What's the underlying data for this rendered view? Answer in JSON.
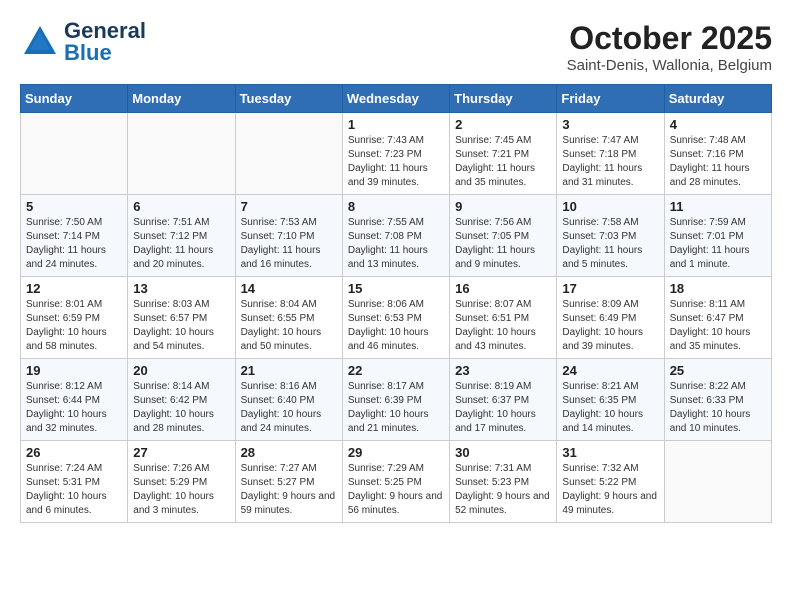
{
  "header": {
    "logo_general": "General",
    "logo_blue": "Blue",
    "month": "October 2025",
    "location": "Saint-Denis, Wallonia, Belgium"
  },
  "days_of_week": [
    "Sunday",
    "Monday",
    "Tuesday",
    "Wednesday",
    "Thursday",
    "Friday",
    "Saturday"
  ],
  "weeks": [
    [
      {
        "num": "",
        "info": ""
      },
      {
        "num": "",
        "info": ""
      },
      {
        "num": "",
        "info": ""
      },
      {
        "num": "1",
        "info": "Sunrise: 7:43 AM\nSunset: 7:23 PM\nDaylight: 11 hours\nand 39 minutes."
      },
      {
        "num": "2",
        "info": "Sunrise: 7:45 AM\nSunset: 7:21 PM\nDaylight: 11 hours\nand 35 minutes."
      },
      {
        "num": "3",
        "info": "Sunrise: 7:47 AM\nSunset: 7:18 PM\nDaylight: 11 hours\nand 31 minutes."
      },
      {
        "num": "4",
        "info": "Sunrise: 7:48 AM\nSunset: 7:16 PM\nDaylight: 11 hours\nand 28 minutes."
      }
    ],
    [
      {
        "num": "5",
        "info": "Sunrise: 7:50 AM\nSunset: 7:14 PM\nDaylight: 11 hours\nand 24 minutes."
      },
      {
        "num": "6",
        "info": "Sunrise: 7:51 AM\nSunset: 7:12 PM\nDaylight: 11 hours\nand 20 minutes."
      },
      {
        "num": "7",
        "info": "Sunrise: 7:53 AM\nSunset: 7:10 PM\nDaylight: 11 hours\nand 16 minutes."
      },
      {
        "num": "8",
        "info": "Sunrise: 7:55 AM\nSunset: 7:08 PM\nDaylight: 11 hours\nand 13 minutes."
      },
      {
        "num": "9",
        "info": "Sunrise: 7:56 AM\nSunset: 7:05 PM\nDaylight: 11 hours\nand 9 minutes."
      },
      {
        "num": "10",
        "info": "Sunrise: 7:58 AM\nSunset: 7:03 PM\nDaylight: 11 hours\nand 5 minutes."
      },
      {
        "num": "11",
        "info": "Sunrise: 7:59 AM\nSunset: 7:01 PM\nDaylight: 11 hours\nand 1 minute."
      }
    ],
    [
      {
        "num": "12",
        "info": "Sunrise: 8:01 AM\nSunset: 6:59 PM\nDaylight: 10 hours\nand 58 minutes."
      },
      {
        "num": "13",
        "info": "Sunrise: 8:03 AM\nSunset: 6:57 PM\nDaylight: 10 hours\nand 54 minutes."
      },
      {
        "num": "14",
        "info": "Sunrise: 8:04 AM\nSunset: 6:55 PM\nDaylight: 10 hours\nand 50 minutes."
      },
      {
        "num": "15",
        "info": "Sunrise: 8:06 AM\nSunset: 6:53 PM\nDaylight: 10 hours\nand 46 minutes."
      },
      {
        "num": "16",
        "info": "Sunrise: 8:07 AM\nSunset: 6:51 PM\nDaylight: 10 hours\nand 43 minutes."
      },
      {
        "num": "17",
        "info": "Sunrise: 8:09 AM\nSunset: 6:49 PM\nDaylight: 10 hours\nand 39 minutes."
      },
      {
        "num": "18",
        "info": "Sunrise: 8:11 AM\nSunset: 6:47 PM\nDaylight: 10 hours\nand 35 minutes."
      }
    ],
    [
      {
        "num": "19",
        "info": "Sunrise: 8:12 AM\nSunset: 6:44 PM\nDaylight: 10 hours\nand 32 minutes."
      },
      {
        "num": "20",
        "info": "Sunrise: 8:14 AM\nSunset: 6:42 PM\nDaylight: 10 hours\nand 28 minutes."
      },
      {
        "num": "21",
        "info": "Sunrise: 8:16 AM\nSunset: 6:40 PM\nDaylight: 10 hours\nand 24 minutes."
      },
      {
        "num": "22",
        "info": "Sunrise: 8:17 AM\nSunset: 6:39 PM\nDaylight: 10 hours\nand 21 minutes."
      },
      {
        "num": "23",
        "info": "Sunrise: 8:19 AM\nSunset: 6:37 PM\nDaylight: 10 hours\nand 17 minutes."
      },
      {
        "num": "24",
        "info": "Sunrise: 8:21 AM\nSunset: 6:35 PM\nDaylight: 10 hours\nand 14 minutes."
      },
      {
        "num": "25",
        "info": "Sunrise: 8:22 AM\nSunset: 6:33 PM\nDaylight: 10 hours\nand 10 minutes."
      }
    ],
    [
      {
        "num": "26",
        "info": "Sunrise: 7:24 AM\nSunset: 5:31 PM\nDaylight: 10 hours\nand 6 minutes."
      },
      {
        "num": "27",
        "info": "Sunrise: 7:26 AM\nSunset: 5:29 PM\nDaylight: 10 hours\nand 3 minutes."
      },
      {
        "num": "28",
        "info": "Sunrise: 7:27 AM\nSunset: 5:27 PM\nDaylight: 9 hours\nand 59 minutes."
      },
      {
        "num": "29",
        "info": "Sunrise: 7:29 AM\nSunset: 5:25 PM\nDaylight: 9 hours\nand 56 minutes."
      },
      {
        "num": "30",
        "info": "Sunrise: 7:31 AM\nSunset: 5:23 PM\nDaylight: 9 hours\nand 52 minutes."
      },
      {
        "num": "31",
        "info": "Sunrise: 7:32 AM\nSunset: 5:22 PM\nDaylight: 9 hours\nand 49 minutes."
      },
      {
        "num": "",
        "info": ""
      }
    ]
  ]
}
